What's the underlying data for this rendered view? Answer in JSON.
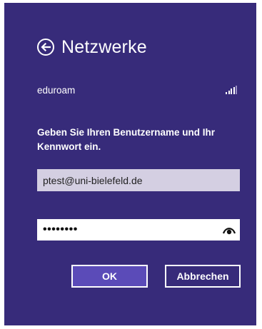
{
  "header": {
    "title": "Netzwerke",
    "back_icon": "back-arrow-circle-icon"
  },
  "network": {
    "name": "eduroam",
    "signal_icon": "signal-strength-icon",
    "signal_bars_filled": 4,
    "signal_bars_total": 5
  },
  "form": {
    "prompt": "Geben Sie Ihren Benutzername und Ihr Kennwort ein.",
    "username_value": "ptest@uni-bielefeld.de",
    "password_masked": "••••••••",
    "reveal_icon": "eye-icon"
  },
  "buttons": {
    "ok_label": "OK",
    "cancel_label": "Abbrechen"
  },
  "colors": {
    "panel_bg": "#372b7a",
    "ok_button_bg": "#5b4bb8",
    "username_field_bg": "#d4cfe2"
  }
}
